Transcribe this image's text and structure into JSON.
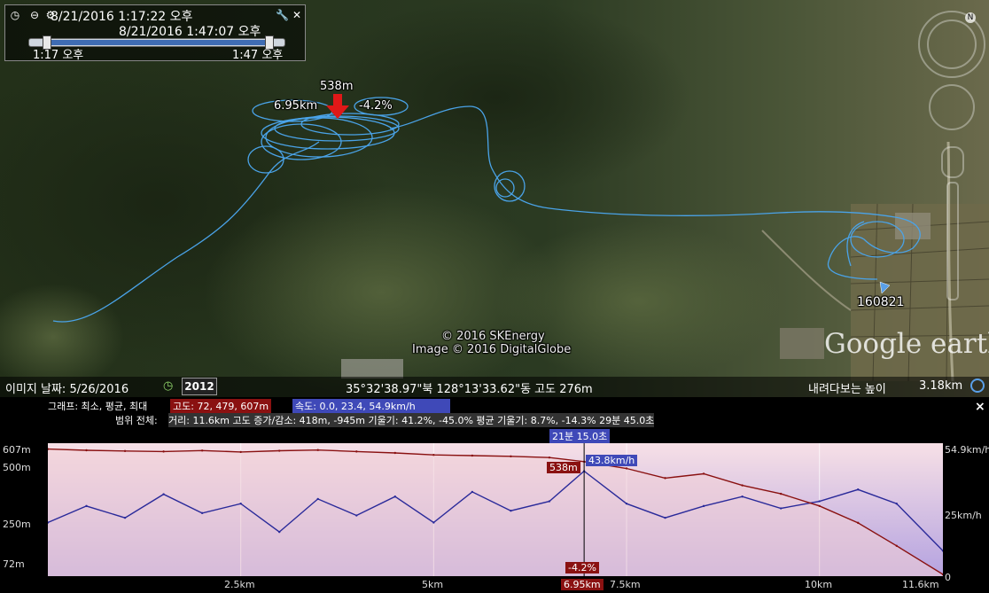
{
  "time_slider": {
    "start_datetime": "8/21/2016   1:17:22 오후",
    "end_datetime": "8/21/2016   1:47:07 오후",
    "start_label": "1:17 오후",
    "end_label": "1:47 오후"
  },
  "map": {
    "point_alt": "538m",
    "point_dist": "6.95km",
    "point_grade": "-4.2%",
    "placemark": "160821",
    "copyright1": "© 2016 SKEnergy",
    "copyright2": "Image © 2016 DigitalGlobe",
    "logo": "Google earth"
  },
  "status": {
    "image_date": "이미지 날짜: 5/26/2016",
    "year": "2012",
    "coords": "35°32'38.97\"북 128°13'33.62\"동 고도   276m",
    "view_label": "내려다보는 높이",
    "view_value": "3.18km"
  },
  "panel": {
    "graph_label": "그래프: 최소, 평균, 최대",
    "alt_stat": "고도: 72, 479, 607m",
    "speed_stat": "속도: 0.0, 23.4, 54.9km/h",
    "range_label": "범위 전체:",
    "range_stat": "거리: 11.6km 고도 증가/감소: 418m, -945m 기울기: 41.2%, -45.0% 평균 기울기: 8.7%, -14.3% 29분 45.0초",
    "time_badge": "21분 15.0초",
    "cursor_alt": "538m",
    "cursor_speed": "43.8km/h",
    "cursor_grade": "-4.2%",
    "cursor_dist": "6.95km",
    "close": "×"
  },
  "chart_data": {
    "type": "line",
    "xlabel": "",
    "ylabel": "",
    "x_ticks": [
      "2.5km",
      "5km",
      "7.5km",
      "10km",
      "11.6km"
    ],
    "y_left_ticks": [
      "607m",
      "500m",
      "250m",
      "72m"
    ],
    "y_right_ticks": [
      "54.9km/h",
      "25km/h",
      "0"
    ],
    "x_range_km": [
      0,
      11.6
    ],
    "series": [
      {
        "name": "고도",
        "color": "#8a1111",
        "x": [
          0,
          0.5,
          1,
          1.5,
          2,
          2.5,
          3,
          3.5,
          4,
          4.5,
          5,
          5.5,
          6,
          6.5,
          6.95,
          7.5,
          8,
          8.5,
          9,
          9.5,
          10,
          10.5,
          11,
          11.6
        ],
        "values": [
          590,
          585,
          582,
          580,
          584,
          578,
          583,
          586,
          580,
          574,
          566,
          563,
          560,
          555,
          538,
          510,
          470,
          488,
          440,
          405,
          355,
          285,
          190,
          72
        ]
      },
      {
        "name": "속도",
        "color": "#2a2a9a",
        "x": [
          0,
          0.5,
          1,
          1.5,
          2,
          2.5,
          3,
          3.5,
          4,
          4.5,
          5,
          5.5,
          6,
          6.5,
          6.95,
          7.5,
          8,
          8.5,
          9,
          9.5,
          10,
          10.5,
          11,
          11.6
        ],
        "values": [
          22,
          29,
          24,
          34,
          26,
          30,
          18,
          32,
          25,
          33,
          22,
          35,
          27,
          31,
          43.8,
          30,
          24,
          29,
          33,
          28,
          31,
          36,
          30,
          10
        ]
      }
    ],
    "alt_ylim": [
      72,
      607
    ],
    "speed_ylim": [
      0,
      54.9
    ]
  },
  "track_color": "#4aa3e8"
}
